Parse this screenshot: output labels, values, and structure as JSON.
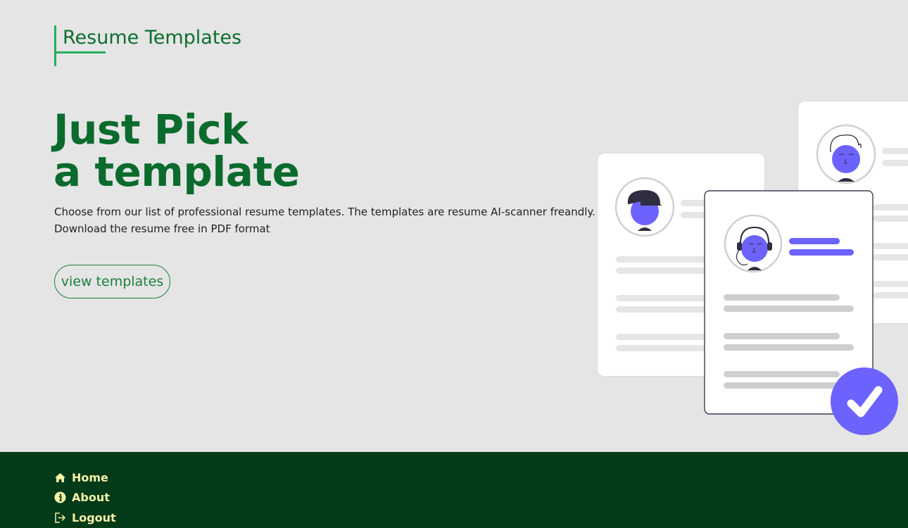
{
  "brand": {
    "name": "Resume Templates"
  },
  "hero": {
    "title_line1": "Just Pick",
    "title_line2": "a template",
    "description_line1": "Choose from our list of professional resume templates. The templates are resume AI-scanner freandly.",
    "description_line2": "Download the resume free in PDF format",
    "cta_label": "view templates"
  },
  "colors": {
    "background": "#e5e5e5",
    "brand_green": "#0a6b2d",
    "accent_green": "#27ae60",
    "footer_bg": "#033a18",
    "footer_text": "#f5f0a6",
    "illustration_accent": "#6c63ff"
  },
  "footer": {
    "items": [
      {
        "label": "Home",
        "icon": "home-icon"
      },
      {
        "label": "About",
        "icon": "info-icon"
      },
      {
        "label": "Logout",
        "icon": "logout-icon"
      }
    ]
  }
}
